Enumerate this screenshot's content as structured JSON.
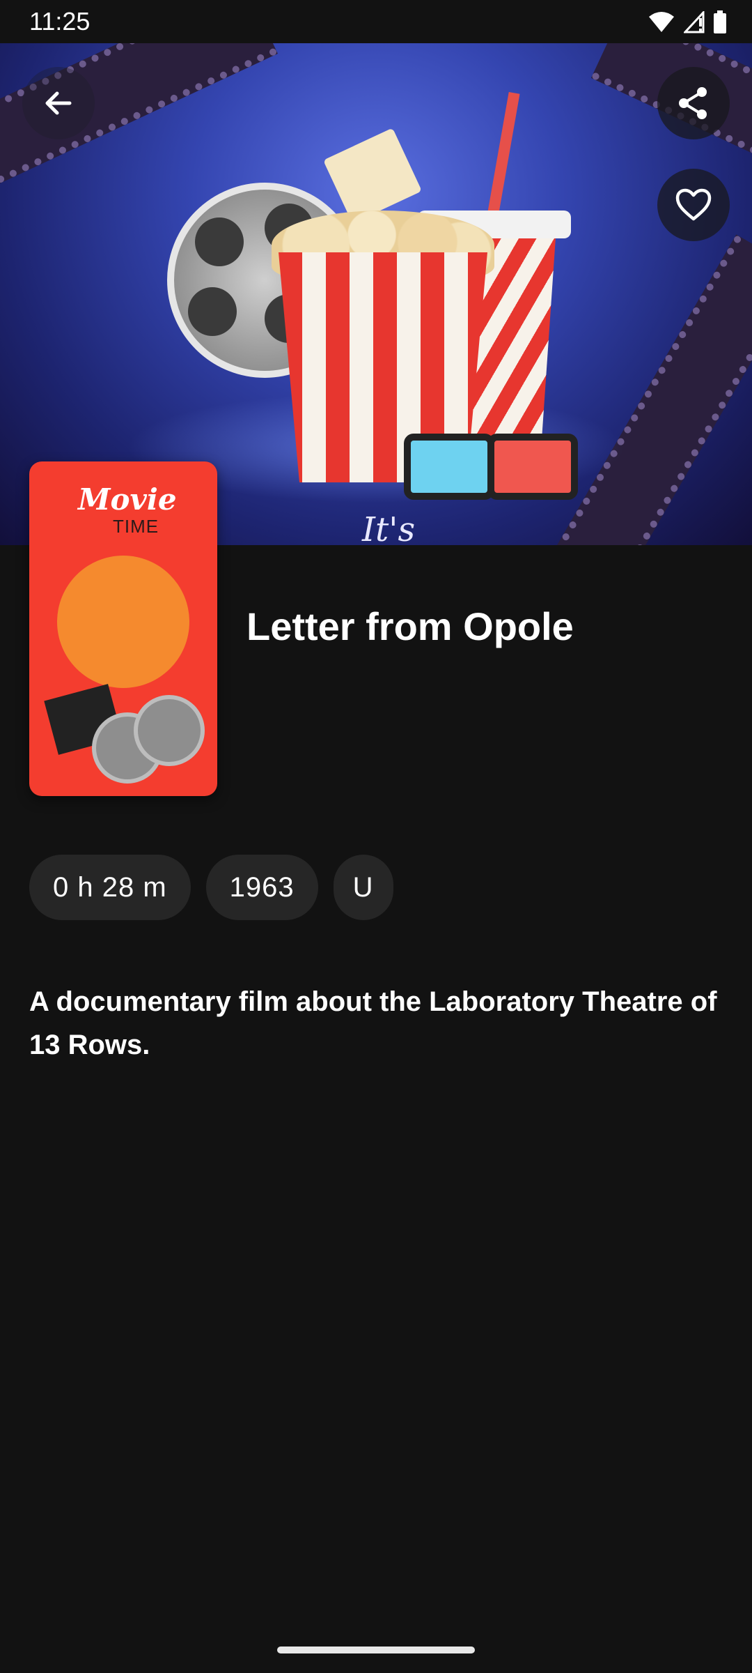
{
  "status_bar": {
    "time": "11:25",
    "icons": [
      "wifi-icon",
      "signal-icon",
      "battery-icon"
    ]
  },
  "hero": {
    "script_text": "It's"
  },
  "actions": {
    "back_icon": "arrow-left-icon",
    "share_icon": "share-icon",
    "favorite_icon": "heart-outline-icon"
  },
  "poster": {
    "title_line1": "Movie",
    "title_line2": "TIME"
  },
  "movie": {
    "title": "Letter from Opole",
    "chips": [
      "0 h 28 m",
      "1963",
      "U"
    ],
    "description": "A documentary film about the Laboratory Theatre of 13 Rows."
  },
  "colors": {
    "background": "#121212",
    "chip": "#262626",
    "poster": "#f43d2f",
    "hero": "#3445b0"
  }
}
